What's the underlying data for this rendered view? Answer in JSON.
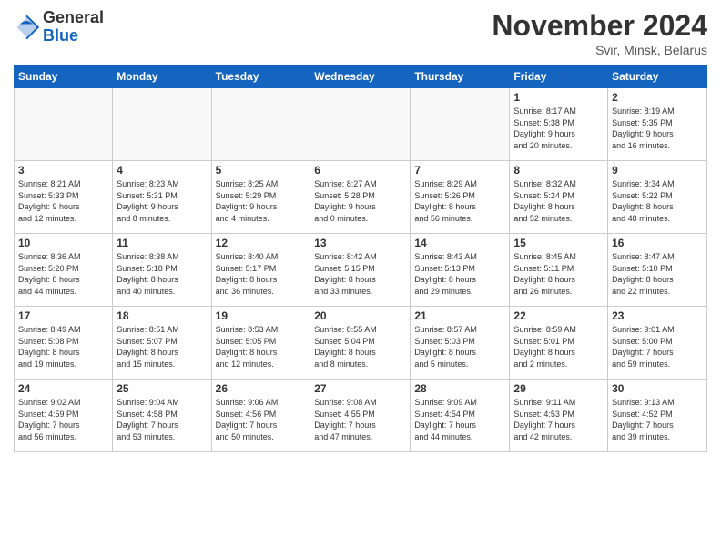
{
  "header": {
    "logo_line1": "General",
    "logo_line2": "Blue",
    "month": "November 2024",
    "location": "Svir, Minsk, Belarus"
  },
  "weekdays": [
    "Sunday",
    "Monday",
    "Tuesday",
    "Wednesday",
    "Thursday",
    "Friday",
    "Saturday"
  ],
  "weeks": [
    [
      {
        "day": "",
        "info": ""
      },
      {
        "day": "",
        "info": ""
      },
      {
        "day": "",
        "info": ""
      },
      {
        "day": "",
        "info": ""
      },
      {
        "day": "",
        "info": ""
      },
      {
        "day": "1",
        "info": "Sunrise: 8:17 AM\nSunset: 5:38 PM\nDaylight: 9 hours\nand 20 minutes."
      },
      {
        "day": "2",
        "info": "Sunrise: 8:19 AM\nSunset: 5:35 PM\nDaylight: 9 hours\nand 16 minutes."
      }
    ],
    [
      {
        "day": "3",
        "info": "Sunrise: 8:21 AM\nSunset: 5:33 PM\nDaylight: 9 hours\nand 12 minutes."
      },
      {
        "day": "4",
        "info": "Sunrise: 8:23 AM\nSunset: 5:31 PM\nDaylight: 9 hours\nand 8 minutes."
      },
      {
        "day": "5",
        "info": "Sunrise: 8:25 AM\nSunset: 5:29 PM\nDaylight: 9 hours\nand 4 minutes."
      },
      {
        "day": "6",
        "info": "Sunrise: 8:27 AM\nSunset: 5:28 PM\nDaylight: 9 hours\nand 0 minutes."
      },
      {
        "day": "7",
        "info": "Sunrise: 8:29 AM\nSunset: 5:26 PM\nDaylight: 8 hours\nand 56 minutes."
      },
      {
        "day": "8",
        "info": "Sunrise: 8:32 AM\nSunset: 5:24 PM\nDaylight: 8 hours\nand 52 minutes."
      },
      {
        "day": "9",
        "info": "Sunrise: 8:34 AM\nSunset: 5:22 PM\nDaylight: 8 hours\nand 48 minutes."
      }
    ],
    [
      {
        "day": "10",
        "info": "Sunrise: 8:36 AM\nSunset: 5:20 PM\nDaylight: 8 hours\nand 44 minutes."
      },
      {
        "day": "11",
        "info": "Sunrise: 8:38 AM\nSunset: 5:18 PM\nDaylight: 8 hours\nand 40 minutes."
      },
      {
        "day": "12",
        "info": "Sunrise: 8:40 AM\nSunset: 5:17 PM\nDaylight: 8 hours\nand 36 minutes."
      },
      {
        "day": "13",
        "info": "Sunrise: 8:42 AM\nSunset: 5:15 PM\nDaylight: 8 hours\nand 33 minutes."
      },
      {
        "day": "14",
        "info": "Sunrise: 8:43 AM\nSunset: 5:13 PM\nDaylight: 8 hours\nand 29 minutes."
      },
      {
        "day": "15",
        "info": "Sunrise: 8:45 AM\nSunset: 5:11 PM\nDaylight: 8 hours\nand 26 minutes."
      },
      {
        "day": "16",
        "info": "Sunrise: 8:47 AM\nSunset: 5:10 PM\nDaylight: 8 hours\nand 22 minutes."
      }
    ],
    [
      {
        "day": "17",
        "info": "Sunrise: 8:49 AM\nSunset: 5:08 PM\nDaylight: 8 hours\nand 19 minutes."
      },
      {
        "day": "18",
        "info": "Sunrise: 8:51 AM\nSunset: 5:07 PM\nDaylight: 8 hours\nand 15 minutes."
      },
      {
        "day": "19",
        "info": "Sunrise: 8:53 AM\nSunset: 5:05 PM\nDaylight: 8 hours\nand 12 minutes."
      },
      {
        "day": "20",
        "info": "Sunrise: 8:55 AM\nSunset: 5:04 PM\nDaylight: 8 hours\nand 8 minutes."
      },
      {
        "day": "21",
        "info": "Sunrise: 8:57 AM\nSunset: 5:03 PM\nDaylight: 8 hours\nand 5 minutes."
      },
      {
        "day": "22",
        "info": "Sunrise: 8:59 AM\nSunset: 5:01 PM\nDaylight: 8 hours\nand 2 minutes."
      },
      {
        "day": "23",
        "info": "Sunrise: 9:01 AM\nSunset: 5:00 PM\nDaylight: 7 hours\nand 59 minutes."
      }
    ],
    [
      {
        "day": "24",
        "info": "Sunrise: 9:02 AM\nSunset: 4:59 PM\nDaylight: 7 hours\nand 56 minutes."
      },
      {
        "day": "25",
        "info": "Sunrise: 9:04 AM\nSunset: 4:58 PM\nDaylight: 7 hours\nand 53 minutes."
      },
      {
        "day": "26",
        "info": "Sunrise: 9:06 AM\nSunset: 4:56 PM\nDaylight: 7 hours\nand 50 minutes."
      },
      {
        "day": "27",
        "info": "Sunrise: 9:08 AM\nSunset: 4:55 PM\nDaylight: 7 hours\nand 47 minutes."
      },
      {
        "day": "28",
        "info": "Sunrise: 9:09 AM\nSunset: 4:54 PM\nDaylight: 7 hours\nand 44 minutes."
      },
      {
        "day": "29",
        "info": "Sunrise: 9:11 AM\nSunset: 4:53 PM\nDaylight: 7 hours\nand 42 minutes."
      },
      {
        "day": "30",
        "info": "Sunrise: 9:13 AM\nSunset: 4:52 PM\nDaylight: 7 hours\nand 39 minutes."
      }
    ]
  ]
}
